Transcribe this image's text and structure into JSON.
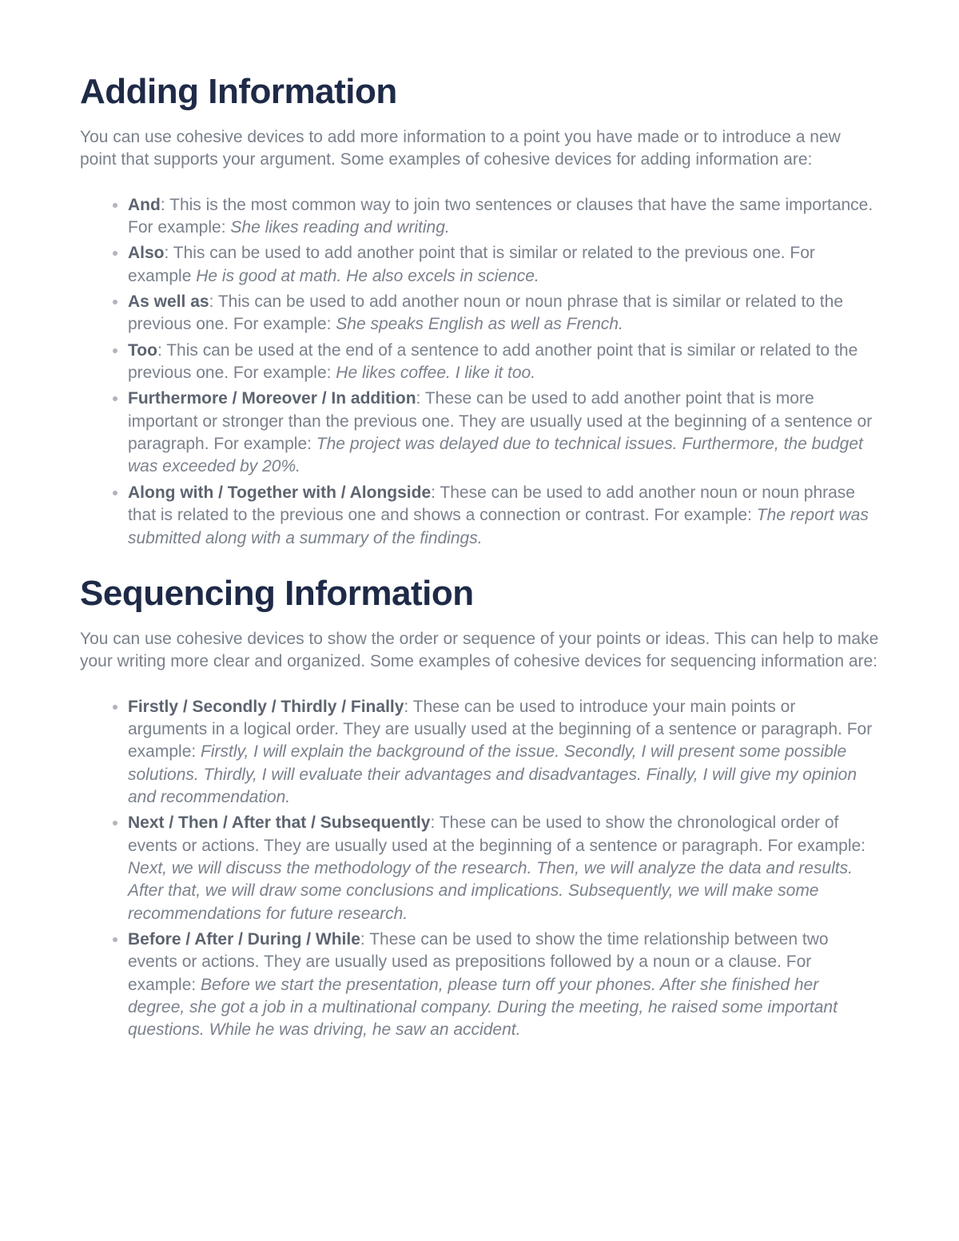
{
  "section1": {
    "title": "Adding Information",
    "intro": "You can use cohesive devices to add more information to a point you have made or to introduce a new point that supports your argument. Some examples of cohesive devices for adding information are:",
    "items": [
      {
        "term": "And",
        "desc": ": This is the most common way to join two sentences or clauses that have the same importance. For example: ",
        "example": "She likes reading and writing."
      },
      {
        "term": "Also",
        "desc": ": This can be used to add another point that is similar or related to the previous one. For example ",
        "example": "He is good at math. He also excels in science."
      },
      {
        "term": "As well as",
        "desc": ": This can be used to add another noun or noun phrase that is similar or related to the previous one. For example: ",
        "example": "She speaks English as well as French."
      },
      {
        "term": "Too",
        "desc": ": This can be used at the end of a sentence to add another point that is similar or related to the previous one. For example: ",
        "example": "He likes coffee. I like it too."
      },
      {
        "term": "Furthermore / Moreover / In addition",
        "desc": ": These can be used to add another point that is more important or stronger than the previous one. They are usually used at the beginning of a sentence or paragraph. For example: ",
        "example": "The project was delayed due to technical issues. Furthermore, the budget was exceeded by 20%."
      },
      {
        "term": "Along with / Together with / Alongside",
        "desc": ": These can be used to add another noun or noun phrase that is related to the previous one and shows a connection or contrast. For example: ",
        "example": "The report was submitted along with a summary of the findings."
      }
    ]
  },
  "section2": {
    "title": "Sequencing Information",
    "intro": "You can use cohesive devices to show the order or sequence of your points or ideas. This can help to make your writing more clear and organized. Some examples of cohesive devices for sequencing information are:",
    "items": [
      {
        "term": "Firstly / Secondly / Thirdly / Finally",
        "desc": ": These can be used to introduce your main points or arguments in a logical order. They are usually used at the beginning of a sentence or paragraph. For example: ",
        "example": "Firstly, I will explain the background of the issue. Secondly, I will present some possible solutions. Thirdly, I will evaluate their advantages and disadvantages. Finally, I will give my opinion and recommendation."
      },
      {
        "term": "Next / Then / After that / Subsequently",
        "desc": ": These can be used to show the chronological order of events or actions. They are usually used at the beginning of a sentence or paragraph. For example: ",
        "example": "Next, we will discuss the methodology of the research. Then, we will analyze the data and results. After that, we will draw some conclusions and implications. Subsequently, we will make some recommendations for future research."
      },
      {
        "term": "Before / After / During / While",
        "desc": ": These can be used to show the time relationship between two events or actions. They are usually used as prepositions followed by a noun or a clause. For example: ",
        "example": "Before we start the presentation, please turn off your phones. After she finished her degree, she got a job in a multinational company. During the meeting, he raised some important questions. While he was driving, he saw an accident."
      }
    ]
  }
}
